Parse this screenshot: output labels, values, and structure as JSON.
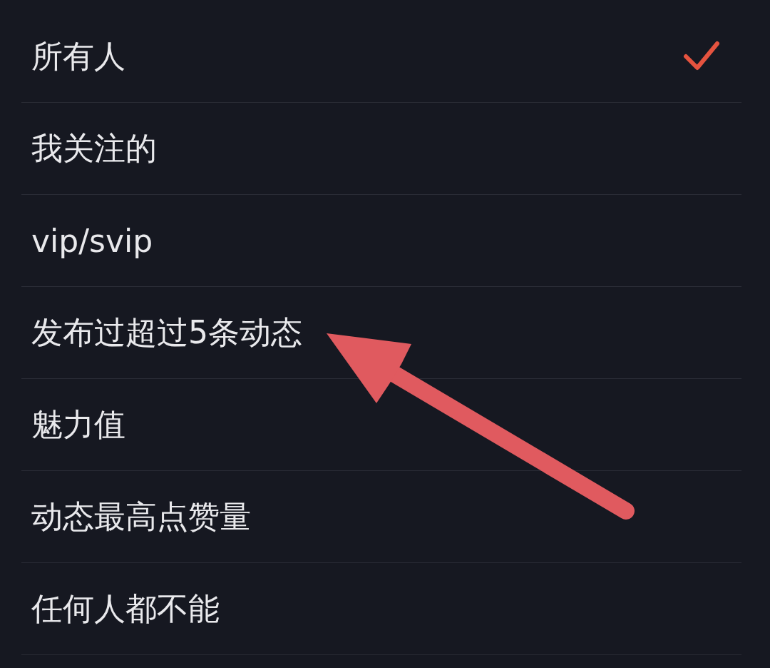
{
  "options": [
    {
      "label": "所有人",
      "selected": true,
      "annotated": false
    },
    {
      "label": "我关注的",
      "selected": false,
      "annotated": false
    },
    {
      "label": "vip/svip",
      "selected": false,
      "annotated": false
    },
    {
      "label": "发布过超过5条动态",
      "selected": false,
      "annotated": true
    },
    {
      "label": "魅力值",
      "selected": false,
      "annotated": false
    },
    {
      "label": "动态最高点赞量",
      "selected": false,
      "annotated": false
    },
    {
      "label": "任何人都不能",
      "selected": false,
      "annotated": false
    }
  ]
}
